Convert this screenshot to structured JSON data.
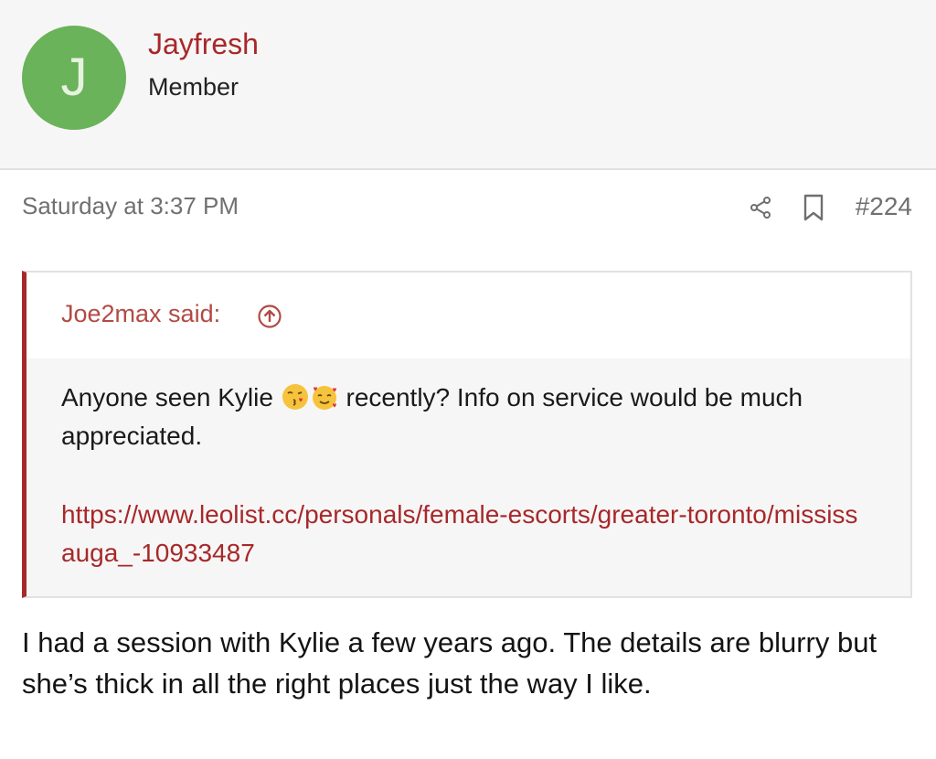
{
  "user": {
    "avatar_letter": "J",
    "name": "Jayfresh",
    "title": "Member"
  },
  "post": {
    "timestamp": "Saturday at 3:37 PM",
    "number": "#224",
    "body": "I had a session with Kylie a few years ago. The details are blurry but she’s thick in all the right places just the way I like."
  },
  "quote": {
    "author": "Joe2max said:",
    "text_before": "Anyone seen Kylie ",
    "text_after": " recently? Info on service would be much appreciated.",
    "link": "https://www.leolist.cc/personals/female-escorts/greater-toronto/mississauga_-10933487"
  },
  "icons": {
    "share": "share-icon",
    "bookmark": "bookmark-icon",
    "quote_jump": "arrow-up-circle-icon",
    "emoji_1": "kissing-face-emoji",
    "emoji_2": "smiling-face-with-hearts-emoji"
  },
  "colors": {
    "accent": "#a7282a",
    "avatar": "#6ab35a"
  }
}
